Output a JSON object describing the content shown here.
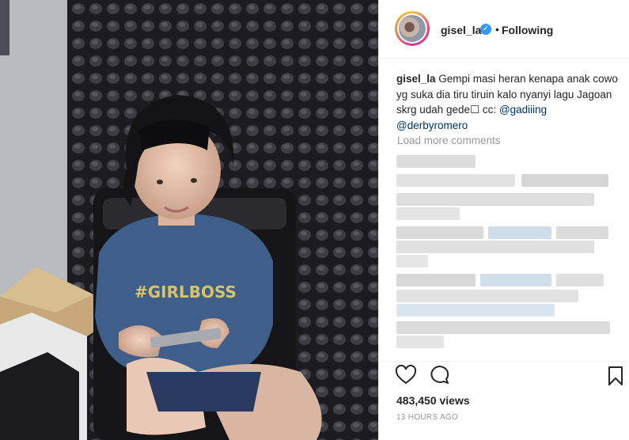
{
  "post": {
    "username": "gisel_la",
    "verified_mark": "✓",
    "separator": "•",
    "follow_status": "Following",
    "caption_user": "gisel_la",
    "caption_text": " Gempi masi heran kenapa anak cowo yg suka dia tiru tiruin kalo nyanyi lagu Jagoan skrg udah gede☐ cc: ",
    "mentions": [
      "@gadiiing",
      "@derbyromero"
    ],
    "load_more": "Load more comments",
    "views": "483,450 views",
    "timestamp": "13 HOURS AGO",
    "shirt_text": "#GIRLBOSS"
  },
  "icons": {
    "like": "heart-icon",
    "comment": "comment-bubble-icon",
    "save": "bookmark-icon",
    "verified": "verified-badge-icon"
  },
  "colors": {
    "link": "#003569",
    "muted": "#999999",
    "text": "#262626",
    "verified": "#3897f0"
  }
}
